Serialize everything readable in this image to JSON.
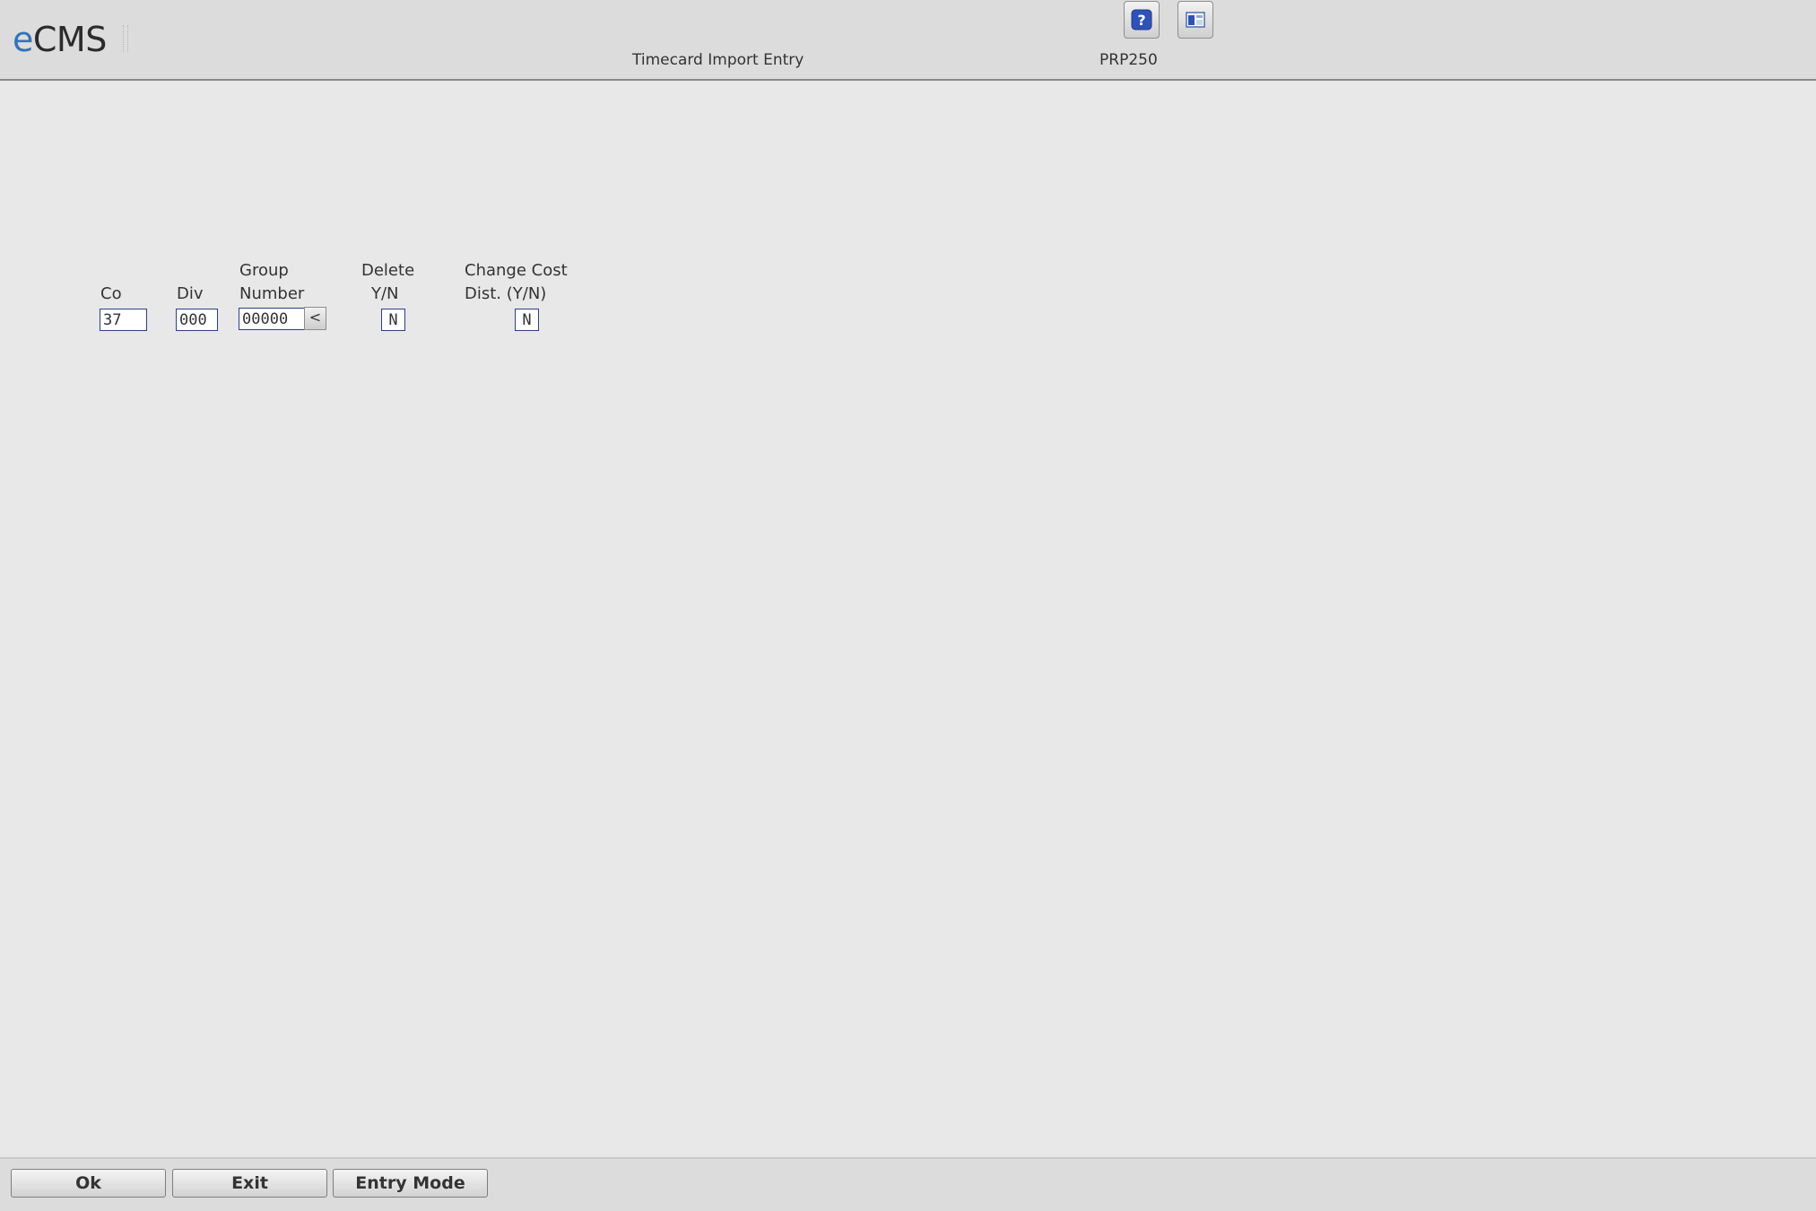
{
  "header": {
    "logo_prefix": "e",
    "logo_suffix": "CMS",
    "screen_title": "Timecard Import Entry",
    "program_id": "PRP250",
    "help_icon": "help-question-icon",
    "window_icon": "window-layout-icon"
  },
  "form": {
    "company": {
      "label": "Co",
      "value": "37"
    },
    "division": {
      "label": "Div",
      "value": "000"
    },
    "group_number": {
      "label_line1": "Group",
      "label_line2": "Number",
      "value": "00000",
      "prompt_glyph": "<"
    },
    "delete_yn": {
      "label_line1": "Delete",
      "label_line2": "Y/N",
      "value": "N"
    },
    "change_cost_dist": {
      "label_line1": "Change Cost",
      "label_line2": "Dist. (Y/N)",
      "value": "N"
    }
  },
  "footer": {
    "ok_label": "Ok",
    "exit_label": "Exit",
    "entry_mode_label": "Entry Mode"
  },
  "colors": {
    "background": "#e8e8e8",
    "header": "#dcdcdc",
    "input_border": "#2a3f8a",
    "logo_accent": "#3472b8",
    "help_icon": "#2f52b8"
  }
}
